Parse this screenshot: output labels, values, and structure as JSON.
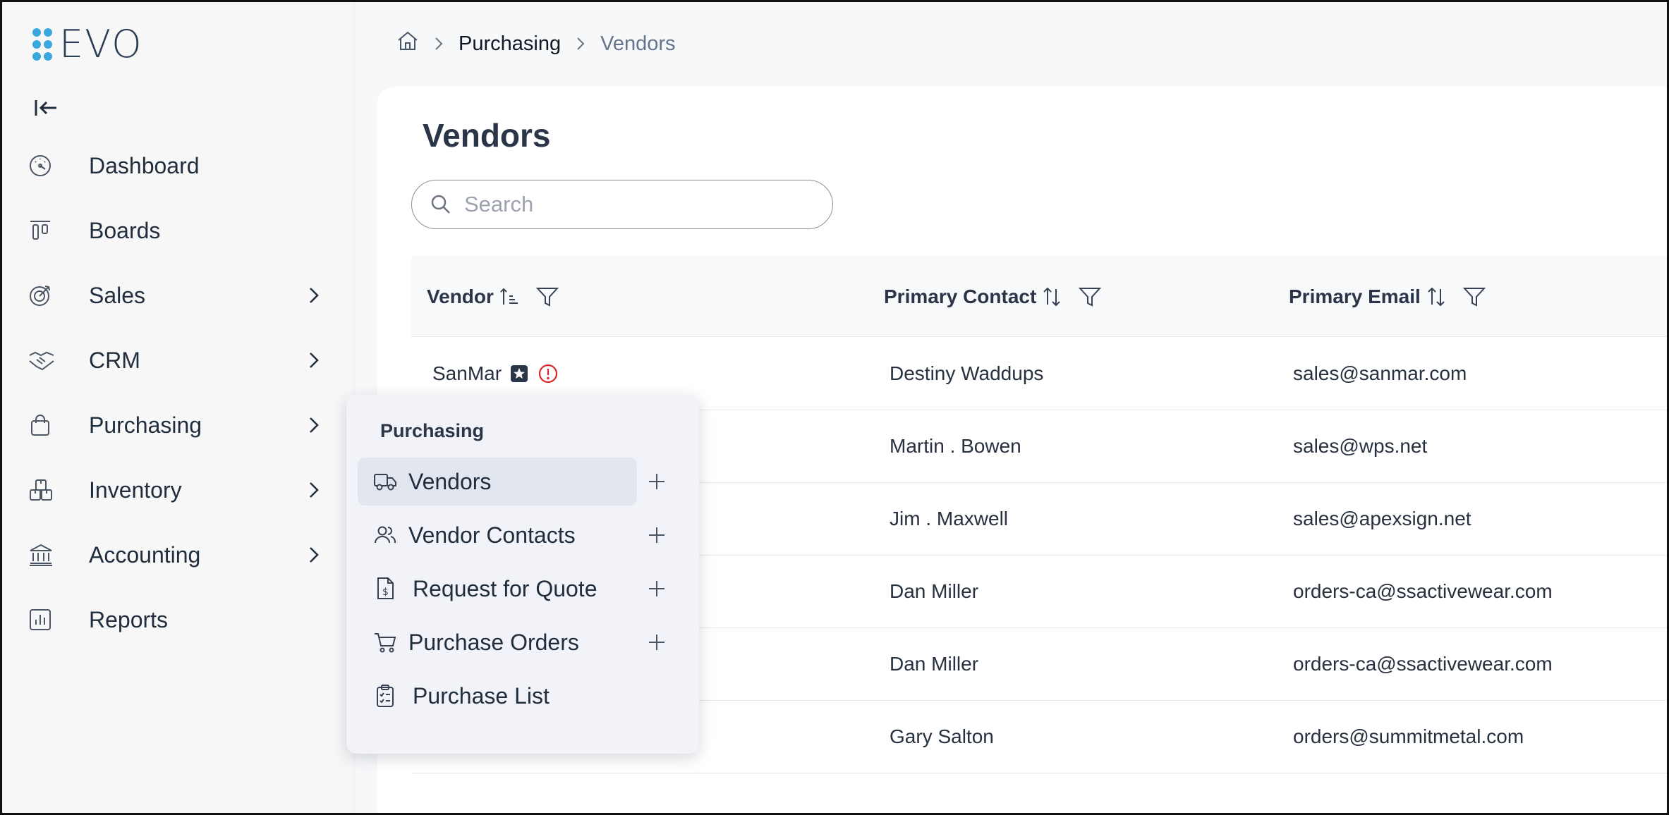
{
  "app": {
    "logo_text": "EVO"
  },
  "sidebar": {
    "items": [
      {
        "label": "Dashboard",
        "icon": "gauge-icon",
        "has_submenu": false
      },
      {
        "label": "Boards",
        "icon": "boards-icon",
        "has_submenu": false
      },
      {
        "label": "Sales",
        "icon": "target-icon",
        "has_submenu": true
      },
      {
        "label": "CRM",
        "icon": "handshake-icon",
        "has_submenu": true
      },
      {
        "label": "Purchasing",
        "icon": "shopping-bag-icon",
        "has_submenu": true
      },
      {
        "label": "Inventory",
        "icon": "boxes-icon",
        "has_submenu": true
      },
      {
        "label": "Accounting",
        "icon": "bank-icon",
        "has_submenu": true
      },
      {
        "label": "Reports",
        "icon": "bar-chart-icon",
        "has_submenu": false
      }
    ]
  },
  "breadcrumb": {
    "section": "Purchasing",
    "page": "Vendors"
  },
  "main": {
    "title": "Vendors",
    "search": {
      "placeholder": "Search",
      "value": ""
    },
    "columns": {
      "vendor": "Vendor",
      "primary_contact": "Primary Contact",
      "primary_email": "Primary Email"
    },
    "rows": [
      {
        "vendor": "SanMar",
        "contact": "Destiny Waddups",
        "email": "sales@sanmar.com",
        "preferred": true,
        "alert": true
      },
      {
        "vendor": "",
        "contact": "Martin . Bowen",
        "email": "sales@wps.net"
      },
      {
        "vendor": "",
        "contact": "Jim . Maxwell",
        "email": "sales@apexsign.net"
      },
      {
        "vendor": "",
        "contact": "Dan Miller",
        "email": "orders-ca@ssactivewear.com"
      },
      {
        "vendor": "",
        "contact": "Dan Miller",
        "email": "orders-ca@ssactivewear.com"
      },
      {
        "vendor": "",
        "contact": "Gary Salton",
        "email": "orders@summitmetal.com"
      }
    ]
  },
  "popup": {
    "title": "Purchasing",
    "items": [
      {
        "label": "Vendors",
        "icon": "truck-icon",
        "active": true,
        "has_add": true
      },
      {
        "label": "Vendor Contacts",
        "icon": "users-icon",
        "active": false,
        "has_add": true
      },
      {
        "label": "Request for Quote",
        "icon": "invoice-dollar-icon",
        "active": false,
        "has_add": true
      },
      {
        "label": "Purchase Orders",
        "icon": "cart-icon",
        "active": false,
        "has_add": true
      },
      {
        "label": "Purchase List",
        "icon": "clipboard-list-icon",
        "active": false,
        "has_add": false
      }
    ]
  },
  "colors": {
    "accent_logo": "#3aa8de",
    "text_dark": "#1f2d3d",
    "alert_red": "#dc2626",
    "active_item_bg": "#e2e7ef"
  }
}
